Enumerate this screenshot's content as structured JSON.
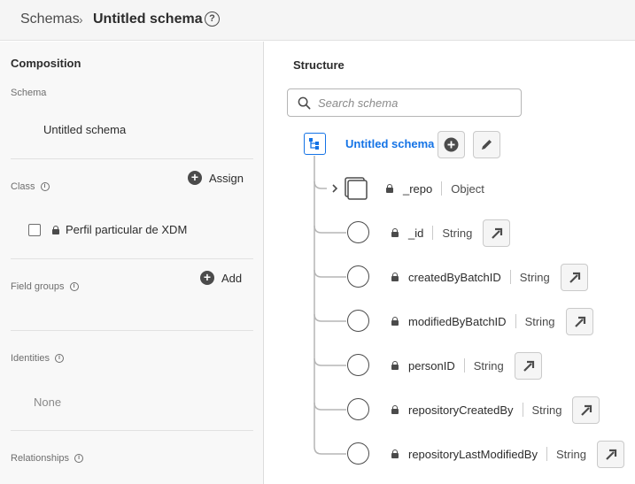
{
  "breadcrumb": {
    "root": "Schemas",
    "separator": "›",
    "current": "Untitled schema"
  },
  "help_icon": "?",
  "composition": {
    "heading": "Composition",
    "schema_label": "Schema",
    "schema_name": "Untitled schema",
    "class_label": "Class",
    "assign_label": "Assign",
    "class_item": "Perfil particular de XDM",
    "field_groups_label": "Field groups",
    "add_label": "Add",
    "identities_label": "Identities",
    "identities_value": "None",
    "relationships_label": "Relationships"
  },
  "structure": {
    "heading": "Structure",
    "search_placeholder": "Search schema",
    "root_name": "Untitled schema",
    "fields": [
      {
        "name": "_repo",
        "type": "Object"
      },
      {
        "name": "_id",
        "type": "String"
      },
      {
        "name": "createdByBatchID",
        "type": "String"
      },
      {
        "name": "modifiedByBatchID",
        "type": "String"
      },
      {
        "name": "personID",
        "type": "String"
      },
      {
        "name": "repositoryCreatedBy",
        "type": "String"
      },
      {
        "name": "repositoryLastModifiedBy",
        "type": "String"
      }
    ]
  },
  "colors": {
    "accent": "#1473e6",
    "header_bg": "#f5f5f5",
    "panel_bg": "#f8f8f8",
    "text": "#2c2c2c",
    "muted": "#6e6e6e"
  },
  "icons": {
    "help": "help-icon",
    "info": "info-icon",
    "add": "plus-circle-icon",
    "lock": "lock-icon",
    "search": "search-icon",
    "schema_tree": "schema-tree-icon",
    "edit": "pencil-icon",
    "expand": "chevron-right-icon",
    "object": "object-stack-icon",
    "field": "field-circle-icon",
    "open": "arrow-up-right-icon"
  }
}
